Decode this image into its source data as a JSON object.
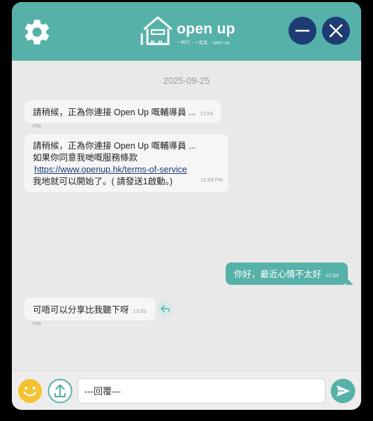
{
  "header": {
    "logo_text": "open up",
    "logo_tagline": "一同行 · 一起走 · open up"
  },
  "chat": {
    "date": "2025-09-25",
    "messages": [
      {
        "direction": "in",
        "text": "請稍候，正為你連接 Open Up 嘅輔導員 ...",
        "time": "12:53 PM"
      },
      {
        "direction": "in",
        "line1": "請稍候，正為你連接 Open Up 嘅輔導員 ...",
        "line2": "如果你同意我哋嘅服務條款",
        "link": "https://www.openup.hk/terms-of-service",
        "line4": "我地就可以開始了。( 請發送1啟動。)",
        "time": "12:53 PM"
      },
      {
        "direction": "out",
        "text": "你好，最近心情不太好",
        "time": "12:54 PM"
      },
      {
        "direction": "in",
        "text": "可唔可以分享比我聽下呀",
        "time": "12:53 PM"
      }
    ]
  },
  "footer": {
    "input_placeholder": "---回覆---"
  },
  "colors": {
    "brand_teal": "#56b1a9",
    "header_button": "#1e3c73",
    "emoji_yellow": "#f5c12e",
    "link": "#1c3a78"
  },
  "icons": {
    "settings": "gear-icon",
    "minimize": "minus-icon",
    "close": "close-icon",
    "reply": "reply-icon",
    "emoji": "smiley-icon",
    "upload": "upload-icon",
    "send": "send-icon"
  }
}
